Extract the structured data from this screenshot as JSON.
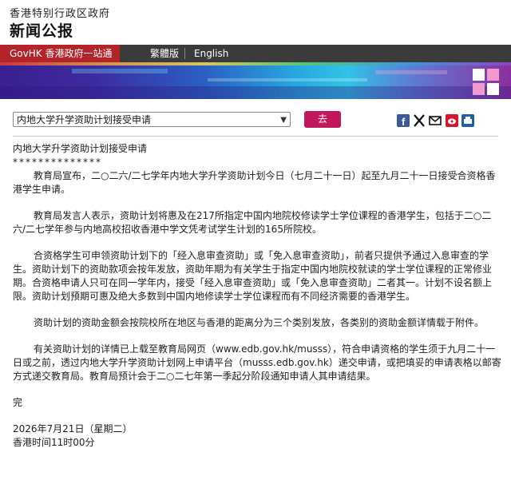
{
  "header": {
    "gov_name": "香港特别行政区政府",
    "section_title": "新闻公报"
  },
  "nav": {
    "govhk": "GovHK 香港政府一站通",
    "traditional": "繁體版",
    "english": "English"
  },
  "toolbar": {
    "select_value": "内地大学升学资助计划接受申请",
    "go_label": "去"
  },
  "article": {
    "title": "内地大学升学资助计划接受申请",
    "stars": "**************",
    "paragraphs": [
      "教育局宣布，二○二六/二七学年内地大学升学资助计划今日（七月二十一日）起至九月二十一日接受合资格香港学生申请。",
      "教育局发言人表示，资助计划将惠及在217所指定中国内地院校修读学士学位课程的香港学生，包括于二○二六/二七学年参与内地高校招收香港中学文凭考试学生计划的165所院校。",
      "合资格学生可申领资助计划下的「经入息审查资助」或「免入息审查资助」，前者只提供予通过入息审查的学生。资助计划下的资助款项会按年发放，资助年期为有关学生于指定中国内地院校就读的学士学位课程的正常修业期。合资格申请人只可在同一学年内，接受「经入息审查资助」或「免入息审查资助」二者其一。计划不设名额上限。资助计划预期可惠及绝大多数到中国内地修读学士学位课程而有不同经济需要的香港学生。",
      "资助计划的资助金额会按院校所在地区与香港的距离分为三个类别发放，各类别的资助金额详情载于附件。",
      "有关资助计划的详情已上载至教育局网页（www.edb.gov.hk/musss），符合申请资格的学生须于九月二十一日或之前，透过内地大学升学资助计划网上申请平台（musss.edb.gov.hk）递交申请，或把填妥的申请表格以邮寄方式递交教育局。教育局预计会于二○二七年第一季起分阶段通知申请人其申请结果。"
    ],
    "end": "完",
    "date": "2026年7月21日（星期二）",
    "time": "香港时间11时00分"
  },
  "share_icons": [
    "facebook-icon",
    "x-icon",
    "email-icon",
    "weibo-icon",
    "print-icon"
  ],
  "colors": {
    "nav_bg": "#3b3b3b",
    "govhk_red": "#b2242a",
    "go_button": "#c2185b",
    "facebook": "#3b5998"
  }
}
